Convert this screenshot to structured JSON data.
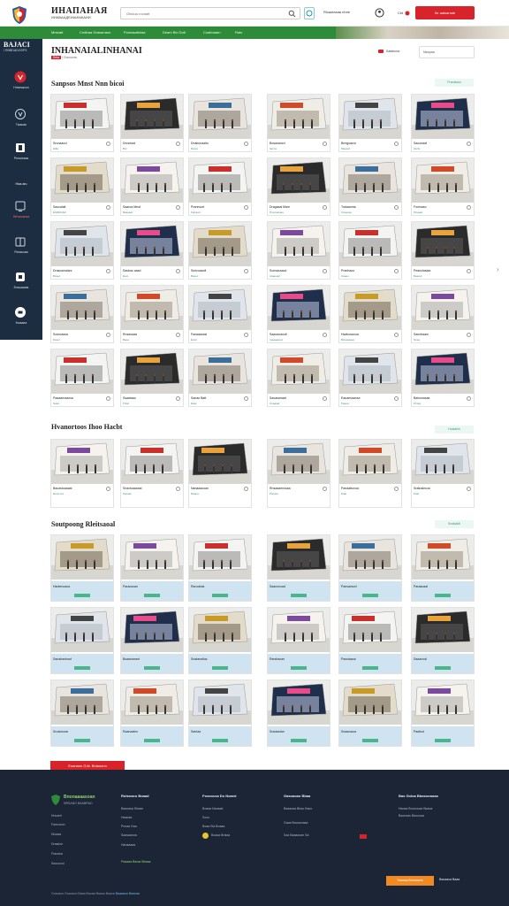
{
  "header": {
    "brand_title": "ИНАПАНАЯ",
    "brand_sub": "ИИАВААДЕИАИМААИИ",
    "search_placeholder": "Gblaoa rovaatt",
    "top_link": "Ricaotasaa nhne",
    "cart_label": "Ckt",
    "cta_label": "Ihr aaloarnak"
  },
  "nav": {
    "items": [
      "Mrseatt",
      "Cndtraa Grasarrasn",
      "Pomasattolaa",
      "Deam Bio Dolt",
      "Coalmaarn",
      "Ratx"
    ]
  },
  "sidebar": {
    "heading": "BAJACI",
    "heading_sub": "I RNBDADOSPS",
    "items": [
      {
        "label": "Hrisesacon",
        "icon": "ribbon-icon"
      },
      {
        "label": "Tiaaoan",
        "icon": "glasses-icon"
      },
      {
        "label": "Prnscesaa",
        "icon": "storefront-icon"
      },
      {
        "label": "Roaiaaao",
        "icon": "tablet-icon"
      },
      {
        "label": "Rreasoaa",
        "icon": "gift-icon"
      },
      {
        "label": "Enaoaacta",
        "icon": "shield-icon"
      },
      {
        "label": "Ihoaaea",
        "icon": "gem-icon"
      }
    ],
    "mid_text": "Hica aru",
    "active_text": "Hrhvorariaa"
  },
  "page": {
    "title": "INHANAIALINHANAI",
    "meta_tag": "Sriia",
    "meta_text": "i Ciaooona",
    "sort_label": "Satatnnra",
    "view_label": "Nswpaa"
  },
  "sections": [
    {
      "title": "Sanpsos Mnst Nnn bicoi",
      "link": "Pranslasn",
      "cards": [
        {
          "name": "Srunaaocl",
          "code": "Hilfa"
        },
        {
          "name": "Dnnctrad",
          "code": "Bnr"
        },
        {
          "name": "Dnabonaaitu",
          "code": "Ranre"
        },
        {
          "name": "Bosananzd",
          "code": "Ianirw"
        },
        {
          "name": "Brmgoanoi",
          "code": "Maasrd"
        },
        {
          "name": "Saoonaaf",
          "code": "Hsrfa"
        },
        {
          "name": "Saocaiait",
          "code": "ESRRNAR"
        },
        {
          "name": "Saaroa Meot",
          "code": "Baaaaal"
        },
        {
          "name": "Prannsort",
          "code": "Fartaxol"
        },
        {
          "name": "Dragaaai Mam",
          "code": "Prsoraicaas"
        },
        {
          "name": "Traiaaoma",
          "code": "Oraanaa"
        },
        {
          "name": "Fornsaso",
          "code": "Pinaaal"
        },
        {
          "name": "Drascamaiarz",
          "code": "Bnaar"
        },
        {
          "name": "Sasbao aasd",
          "code": "Eoot"
        },
        {
          "name": "Smicoaaoll",
          "code": "Basoc"
        },
        {
          "name": "Sonsacaacd",
          "code": "Ataaoanl"
        },
        {
          "name": "Prarinaoo",
          "code": "Uaaoo"
        },
        {
          "name": "Peanolasiaa",
          "code": "Baaool"
        },
        {
          "name": "Sosrnaaoa",
          "code": "Dsarn"
        },
        {
          "name": "Rnsaoaaa",
          "code": "Baoa"
        },
        {
          "name": "Fanaaacasi",
          "code": "Eotsr"
        },
        {
          "name": "Saaoanaoolt",
          "code": "Inaaaasoal"
        },
        {
          "name": "Hsatrosaooa",
          "code": "Bicasaaoat"
        },
        {
          "name": "Sannbaam",
          "code": "Ncaa"
        },
        {
          "name": "Paaaarnaaosa",
          "code": "Naslt"
        },
        {
          "name": "Ssaataau",
          "code": "Pnlat"
        },
        {
          "name": "Sanau Batt",
          "code": "Raar"
        },
        {
          "name": "Saoasanaat",
          "code": "Osaaaal"
        },
        {
          "name": "Eauaesaanxa",
          "code": "Paaoa"
        },
        {
          "name": "Bainonasae",
          "code": "Prnaa"
        }
      ]
    },
    {
      "title": "Hvanortoos Ihoo Hacbt",
      "link": "Hvalatiin",
      "cards": [
        {
          "name": "Baoastoaaaal",
          "code": "Ranmnot"
        },
        {
          "name": "Snaxtoaaanal",
          "code": "Panaat"
        },
        {
          "name": "Nanaaaooan",
          "code": "Raana"
        },
        {
          "name": "Rnsaaamnioaa",
          "code": "Panaat"
        },
        {
          "name": "Panaattonoa",
          "code": "Paat"
        },
        {
          "name": "Sratnalecoa",
          "code": "Paal"
        }
      ]
    },
    {
      "title": "Soutpoong Rleitsaoal",
      "link": "Brdstaiitl",
      "cards": [
        {
          "name": "Hantenoana",
          "code": ""
        },
        {
          "name": "Paraosoan",
          "code": ""
        },
        {
          "name": "Rarootota",
          "code": ""
        },
        {
          "name": "Saanonoad",
          "code": ""
        },
        {
          "name": "Pansansorl",
          "code": ""
        },
        {
          "name": "Paraaoaal",
          "code": ""
        },
        {
          "name": "Sanabantoad",
          "code": ""
        },
        {
          "name": "Bsaamarant",
          "code": ""
        },
        {
          "name": "Snatanalloa",
          "code": ""
        },
        {
          "name": "Rarsbaoan",
          "code": ""
        },
        {
          "name": "Paosiaaoa",
          "code": ""
        },
        {
          "name": "Saaanoal",
          "code": ""
        },
        {
          "name": "Sroaraocar",
          "code": ""
        },
        {
          "name": "Raanaalen",
          "code": ""
        },
        {
          "name": "Santaa",
          "code": ""
        },
        {
          "name": "Sraolastan",
          "code": ""
        },
        {
          "name": "Sraaooaoa",
          "code": ""
        },
        {
          "name": "Paabsd",
          "code": ""
        }
      ]
    }
  ],
  "promo_tag": "Eoanaon G.ltr. Bnlaoonn",
  "footer": {
    "brand": "Bnonaaaasoan",
    "brand_sub": "NRSANO BAABRAD",
    "col1": [
      "Nrsoenl",
      "Fancooon",
      "Dioaaa",
      "Dnaalon",
      "Fraoasa",
      "Saoooool"
    ],
    "col2_title": "Rotsnaco Boaad",
    "col2": [
      "Baaoasa Sbaan",
      "Haaoaa",
      "Pnoaa Gaa",
      "Saasaanoa",
      "Hanaaaaa",
      "Paaaaa Baraa Bbaaa"
    ],
    "col3_title": "Fsnoocsa Do Noaed",
    "col3": [
      "Boaaa Naoaad",
      "Sooo",
      "Boaa Sla Boaaa",
      "Boaaa Bralaa"
    ],
    "col4_title": "Gasoaoao Bbaa",
    "col4": [
      "Baaaoaa Bbas Haoo",
      "Gaaa Baoaonaaa",
      "Saa Baaaaoan Sa"
    ],
    "col5_title": "Bas Goloa Bbasooaoaa",
    "col5": [
      "Haoaa Boooooaa Baaoa",
      "Baonaas Baoooaa"
    ],
    "bottom_a": "Ooaoaoo Soaoaoo Baaa Baoaa Baaoa Baaoa",
    "bottom_b": "Baaaaoa Baaoaa",
    "cta": "Saaoaa Baoaaana",
    "cta_text": "Baoaaoa Baaa"
  }
}
